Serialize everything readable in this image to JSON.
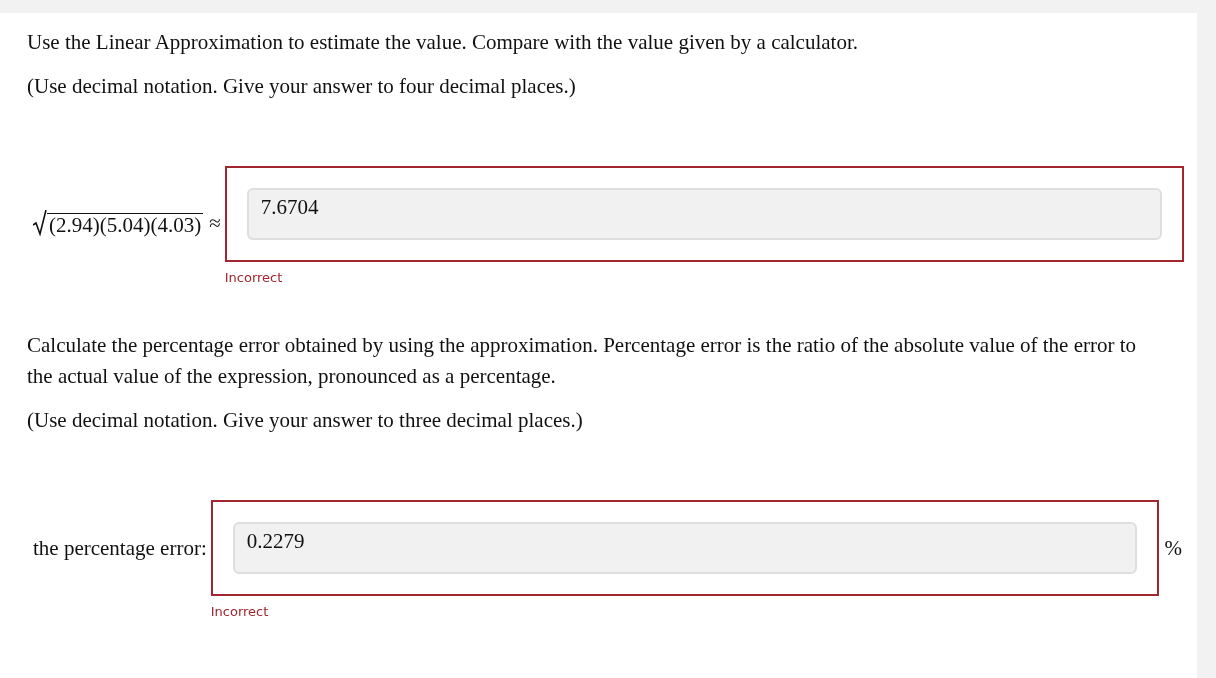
{
  "parts": [
    {
      "paragraphs": [
        "Use the Linear Approximation to estimate the value. Compare with the value given by a calculator.",
        "(Use decimal notation. Give your answer to four decimal places.)"
      ],
      "answer": {
        "kind": "radical",
        "radicand": "(2.94)(5.04)(4.03)",
        "relation": "≈",
        "value": "7.6704",
        "correct": false,
        "feedback": "Incorrect"
      }
    },
    {
      "paragraphs": [
        "Calculate the percentage error obtained by using the approximation. Percentage error is the ratio of the absolute value of the error to the actual value of the expression, pronounced as a percentage.",
        "(Use decimal notation. Give your answer to three decimal places.)"
      ],
      "answer": {
        "kind": "text",
        "label": "the percentage error:",
        "value": "0.2279",
        "unit": "%",
        "correct": false,
        "feedback": "Incorrect"
      }
    }
  ]
}
